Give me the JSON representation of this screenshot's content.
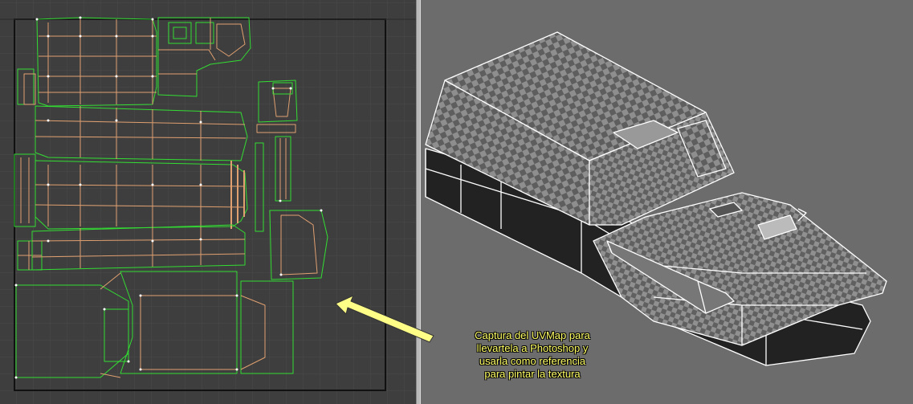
{
  "panels": {
    "uv_editor": {
      "name": "UV editor"
    },
    "viewport_3d": {
      "name": "3D viewport"
    }
  },
  "callout": {
    "lines": [
      "Captura del UVMap para",
      "llevartela a Photoshop y",
      "usarla como referencia",
      "para pintar la textura"
    ]
  },
  "colors": {
    "uv_background": "#3e3e3e",
    "uv_grid": "#4a4a4a",
    "uv_border": "#111111",
    "uv_island_outline": "#33dd33",
    "uv_seam_edges": "#e0a070",
    "uv_vertex": "#ffffff",
    "viewport_background": "#6c6c6c",
    "checker_light": "#8e8e8e",
    "checker_dark": "#5e5e5e",
    "wireframe": "#ffffff",
    "callout_text": "#ffff66",
    "arrow_fill": "#ffff88"
  }
}
